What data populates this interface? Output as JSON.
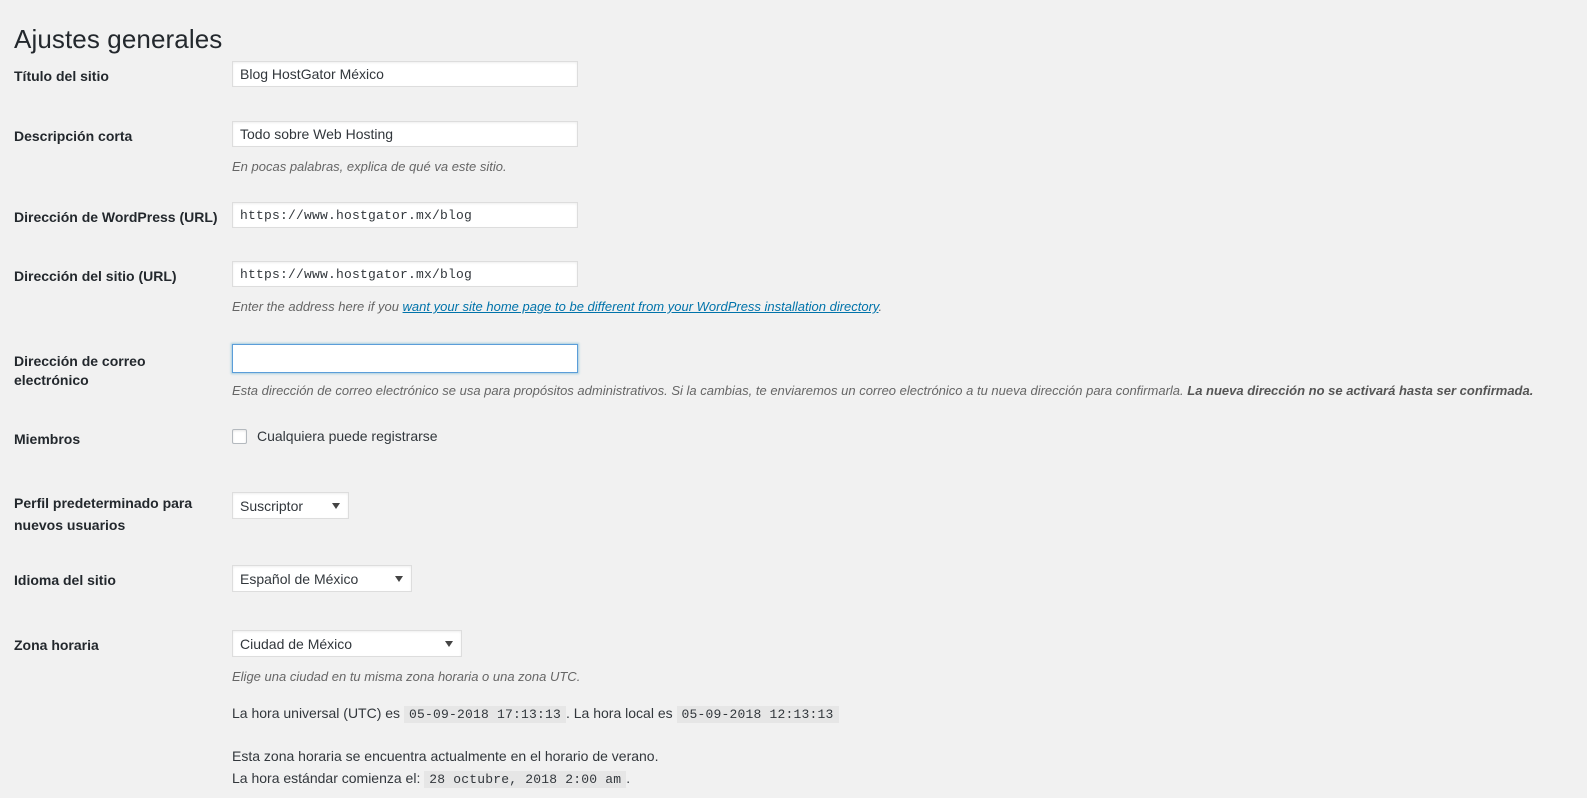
{
  "page": {
    "title": "Ajustes generales"
  },
  "fields": {
    "site_title": {
      "label": "Título del sitio",
      "value": "Blog HostGator México"
    },
    "tagline": {
      "label": "Descripción corta",
      "value": "Todo sobre Web Hosting",
      "description": "En pocas palabras, explica de qué va este sitio."
    },
    "wordpress_url": {
      "label": "Dirección de WordPress (URL)",
      "value": "https://www.hostgator.mx/blog"
    },
    "site_url": {
      "label": "Dirección del sitio (URL)",
      "value": "https://www.hostgator.mx/blog",
      "description_prefix": "Enter the address here if you ",
      "description_link": "want your site home page to be different from your WordPress installation directory",
      "description_suffix": "."
    },
    "admin_email": {
      "label": "Dirección de correo electrónico",
      "value": "",
      "focused": true,
      "description_normal": "Esta dirección de correo electrónico se usa para propósitos administrativos. Si la cambias, te enviaremos un correo electrónico a tu nueva dirección para confirmarla. ",
      "description_bold": "La nueva dirección no se activará hasta ser confirmada."
    },
    "membership": {
      "label": "Miembros",
      "checkbox_label": "Cualquiera puede registrarse",
      "checked": false
    },
    "default_role": {
      "label": "Perfil predeterminado para nuevos usuarios",
      "value": "Suscriptor"
    },
    "site_language": {
      "label": "Idioma del sitio",
      "value": "Español de México"
    },
    "timezone": {
      "label": "Zona horaria",
      "value": "Ciudad de México",
      "description": "Elige una ciudad en tu misma zona horaria o una zona UTC.",
      "utc_prefix": "La hora universal (UTC) es",
      "utc_time": "05-09-2018 17:13:13",
      "local_prefix": ". La hora local es",
      "local_time": "05-09-2018 12:13:13",
      "dst_notice": "Esta zona horaria se encuentra actualmente en el horario de verano.",
      "standard_prefix": "La hora estándar comienza el:",
      "standard_time": "28 octubre, 2018 2:00 am",
      "standard_suffix": "."
    }
  },
  "colors": {
    "background": "#f1f1f1",
    "link": "#0073aa",
    "focus_border": "#5b9dd9",
    "text": "#32373c"
  }
}
